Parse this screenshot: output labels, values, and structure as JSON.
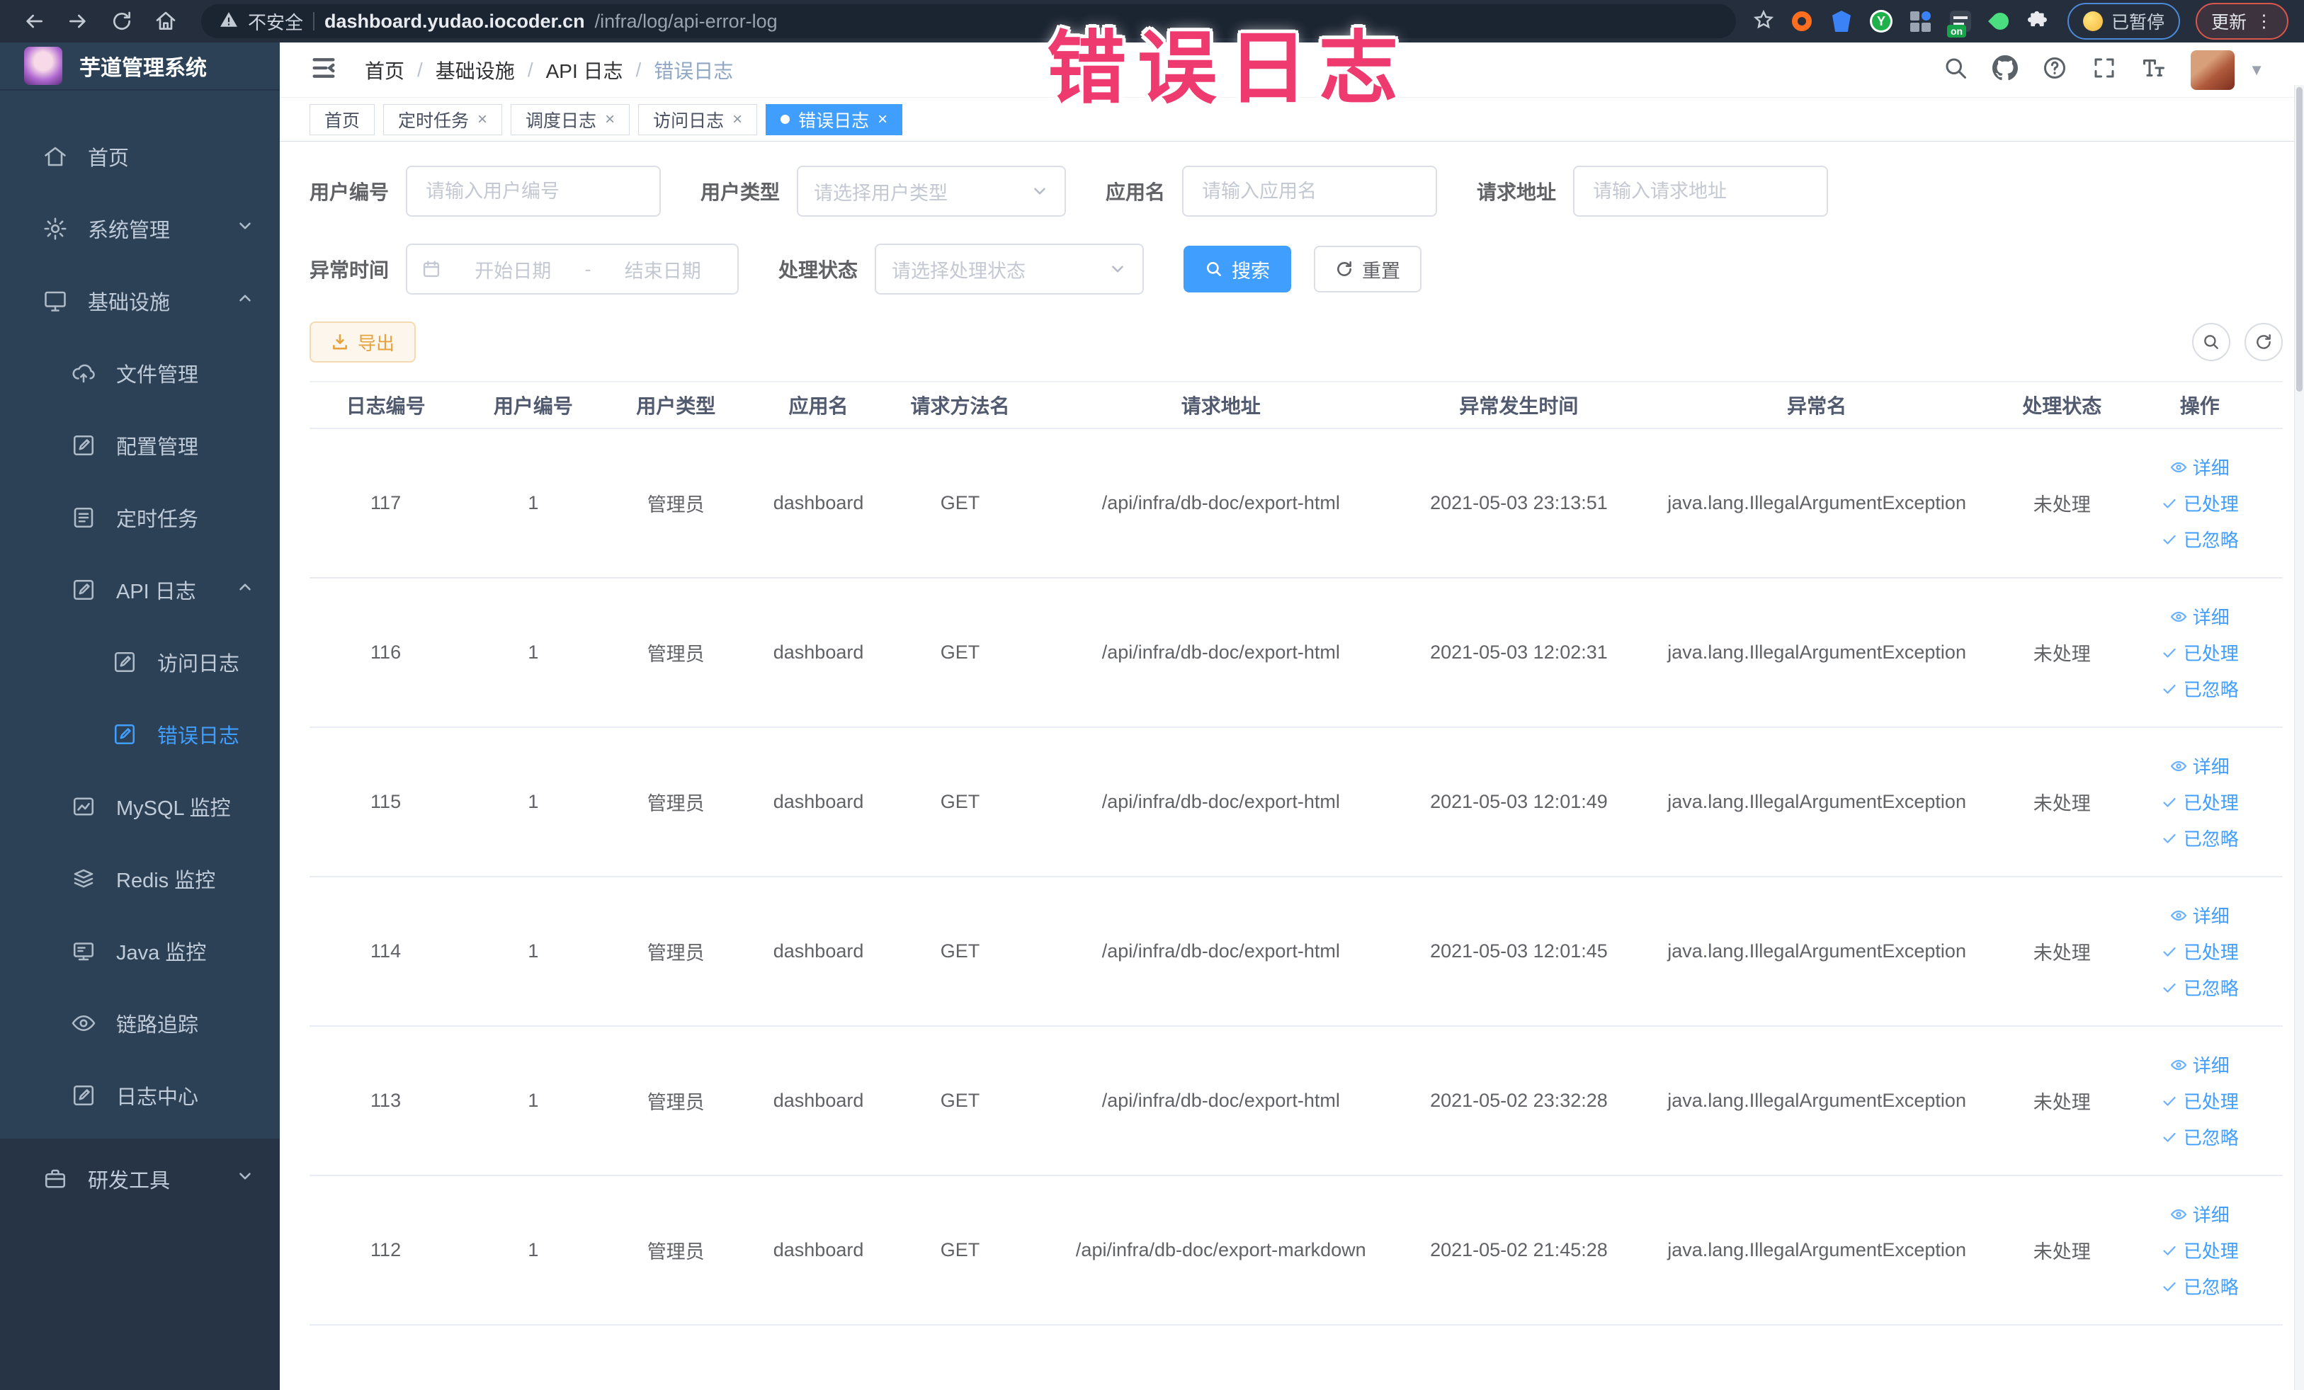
{
  "colors": {
    "accent": "#409eff",
    "warning": "#e6a23c",
    "annotation_pink": "#ee3a6e",
    "sidebar_bg": "#2d4156"
  },
  "browser": {
    "security_label": "不安全",
    "url_host": "dashboard.yudao.iocoder.cn",
    "url_path": "/infra/log/api-error-log",
    "paused_label": "已暂停",
    "update_label": "更新",
    "ext_on_label": "on"
  },
  "annotation_overlay": {
    "text": "错误日志"
  },
  "sidebar": {
    "title": "芋道管理系统",
    "menu": [
      {
        "label": "首页",
        "icon": "home-icon"
      },
      {
        "label": "系统管理",
        "icon": "gear-icon"
      },
      {
        "label": "基础设施",
        "icon": "monitor-icon"
      },
      {
        "label": "文件管理",
        "icon": "upload-cloud-icon"
      },
      {
        "label": "配置管理",
        "icon": "edit-icon"
      },
      {
        "label": "定时任务",
        "icon": "todo-icon"
      },
      {
        "label": "API 日志",
        "icon": "log-edit-icon"
      },
      {
        "label": "访问日志",
        "icon": "log-edit-icon"
      },
      {
        "label": "错误日志",
        "icon": "log-edit-icon"
      },
      {
        "label": "MySQL 监控",
        "icon": "chart-icon"
      },
      {
        "label": "Redis 监控",
        "icon": "layers-icon"
      },
      {
        "label": "Java 监控",
        "icon": "java-monitor-icon"
      },
      {
        "label": "链路追踪",
        "icon": "eye-icon"
      },
      {
        "label": "日志中心",
        "icon": "log-edit-icon"
      },
      {
        "label": "研发工具",
        "icon": "briefcase-icon"
      }
    ]
  },
  "breadcrumb": {
    "separator": "/",
    "items": [
      "首页",
      "基础设施",
      "API 日志",
      "错误日志"
    ]
  },
  "tabs": [
    {
      "label": "首页"
    },
    {
      "label": "定时任务"
    },
    {
      "label": "调度日志"
    },
    {
      "label": "访问日志"
    },
    {
      "label": "错误日志"
    }
  ],
  "filters": {
    "user_id": {
      "label": "用户编号",
      "placeholder": "请输入用户编号"
    },
    "user_type": {
      "label": "用户类型",
      "placeholder": "请选择用户类型"
    },
    "app_name": {
      "label": "应用名",
      "placeholder": "请输入应用名"
    },
    "request_url": {
      "label": "请求地址",
      "placeholder": "请输入请求地址"
    },
    "exception_time": {
      "label": "异常时间",
      "start_placeholder": "开始日期",
      "separator": "-",
      "end_placeholder": "结束日期"
    },
    "process_status": {
      "label": "处理状态",
      "placeholder": "请选择处理状态"
    },
    "search_label": "搜索",
    "reset_label": "重置"
  },
  "toolbar": {
    "export_label": "导出"
  },
  "table": {
    "headers": [
      "日志编号",
      "用户编号",
      "用户类型",
      "应用名",
      "请求方法名",
      "请求地址",
      "异常发生时间",
      "异常名",
      "处理状态",
      "操作"
    ],
    "action_labels": [
      "详细",
      "已处理",
      "已忽略"
    ],
    "rows": [
      {
        "id": "117",
        "user_id": "1",
        "user_type": "管理员",
        "app": "dashboard",
        "method": "GET",
        "url": "/api/infra/db-doc/export-html",
        "time": "2021-05-03 23:13:51",
        "exception": "java.lang.IllegalArgumentException",
        "status": "未处理"
      },
      {
        "id": "116",
        "user_id": "1",
        "user_type": "管理员",
        "app": "dashboard",
        "method": "GET",
        "url": "/api/infra/db-doc/export-html",
        "time": "2021-05-03 12:02:31",
        "exception": "java.lang.IllegalArgumentException",
        "status": "未处理"
      },
      {
        "id": "115",
        "user_id": "1",
        "user_type": "管理员",
        "app": "dashboard",
        "method": "GET",
        "url": "/api/infra/db-doc/export-html",
        "time": "2021-05-03 12:01:49",
        "exception": "java.lang.IllegalArgumentException",
        "status": "未处理"
      },
      {
        "id": "114",
        "user_id": "1",
        "user_type": "管理员",
        "app": "dashboard",
        "method": "GET",
        "url": "/api/infra/db-doc/export-html",
        "time": "2021-05-03 12:01:45",
        "exception": "java.lang.IllegalArgumentException",
        "status": "未处理"
      },
      {
        "id": "113",
        "user_id": "1",
        "user_type": "管理员",
        "app": "dashboard",
        "method": "GET",
        "url": "/api/infra/db-doc/export-html",
        "time": "2021-05-02 23:32:28",
        "exception": "java.lang.IllegalArgumentException",
        "status": "未处理"
      },
      {
        "id": "112",
        "user_id": "1",
        "user_type": "管理员",
        "app": "dashboard",
        "method": "GET",
        "url": "/api/infra/db-doc/export-markdown",
        "time": "2021-05-02 21:45:28",
        "exception": "java.lang.IllegalArgumentException",
        "status": "未处理"
      }
    ]
  }
}
